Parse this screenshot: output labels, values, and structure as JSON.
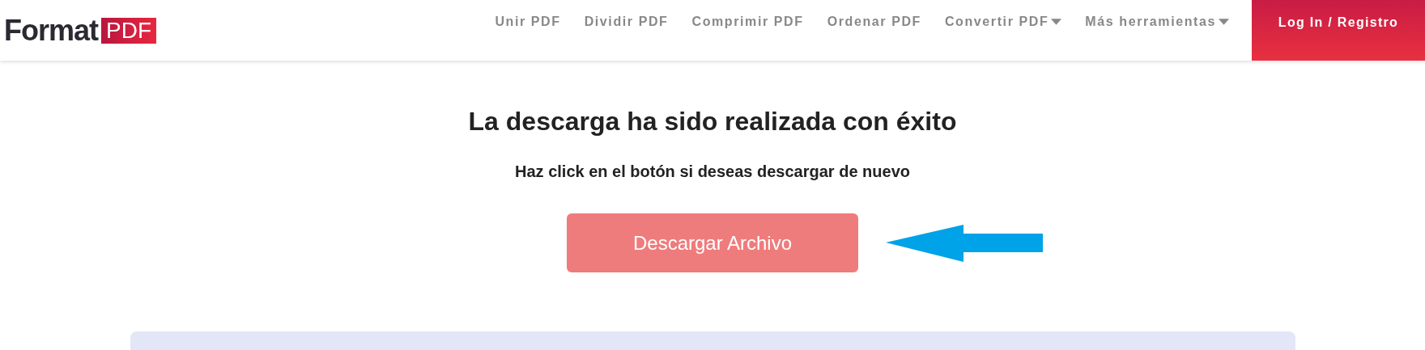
{
  "header": {
    "logo": {
      "word": "Format",
      "badge": "PDF"
    },
    "nav": [
      {
        "label": "Unir PDF",
        "dropdown": false
      },
      {
        "label": "Dividir PDF",
        "dropdown": false
      },
      {
        "label": "Comprimir PDF",
        "dropdown": false
      },
      {
        "label": "Ordenar PDF",
        "dropdown": false
      },
      {
        "label": "Convertir PDF",
        "dropdown": true
      },
      {
        "label": "Más herramientas",
        "dropdown": true
      }
    ],
    "login": "Log In / Registro"
  },
  "main": {
    "title": "La descarga ha sido realizada con éxito",
    "subtitle": "Haz click en el botón si deseas descargar de nuevo",
    "button": "Descargar Archivo"
  }
}
